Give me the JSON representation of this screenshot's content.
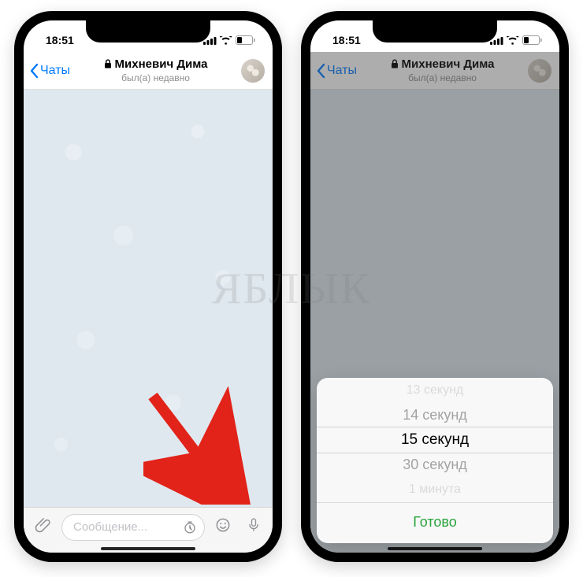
{
  "status": {
    "time": "18:51"
  },
  "nav": {
    "back_label": "Чаты",
    "title": "Михневич Дима",
    "subtitle": "был(а) недавно"
  },
  "input": {
    "placeholder": "Сообщение..."
  },
  "picker": {
    "options": [
      "13 секунд",
      "14 секунд",
      "15 секунд",
      "30 секунд",
      "1 минута"
    ],
    "selected": "15 секунд",
    "done_label": "Готово"
  },
  "watermark": "ЯБЛЫК",
  "colors": {
    "accent_blue": "#007aff",
    "done_green": "#29a33a",
    "arrow_red": "#e2231a",
    "chat_bg": "#dfe8ef"
  }
}
